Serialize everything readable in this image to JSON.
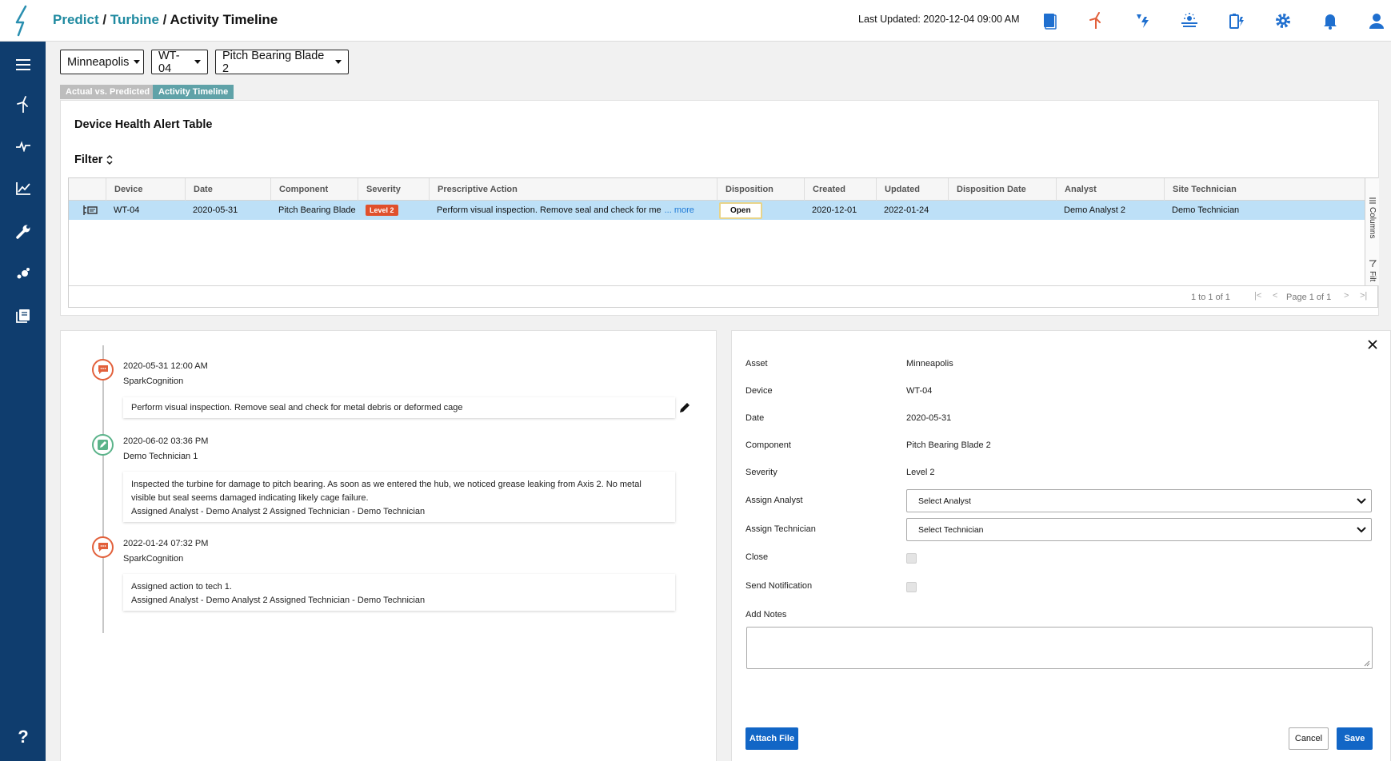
{
  "header": {
    "breadcrumb": [
      {
        "label": "Predict",
        "link": true
      },
      {
        "label": "Turbine",
        "link": true
      },
      {
        "label": "Activity Timeline",
        "link": false
      }
    ],
    "last_updated": "Last Updated: 2020-12-04 09:00 AM",
    "icons": [
      "book-icon",
      "turbine-icon",
      "power-icon",
      "solar-icon",
      "battery-icon",
      "gear-icon",
      "bell-icon",
      "user-icon"
    ]
  },
  "sidebar": {
    "icons": [
      "menu-icon",
      "turbine-icon",
      "pulse-icon",
      "chart-icon",
      "wrench-icon",
      "nodes-icon",
      "library-icon",
      "help-icon"
    ],
    "help_label": "?"
  },
  "selectors": {
    "site": "Minneapolis",
    "device": "WT-04",
    "component": "Pitch Bearing Blade 2"
  },
  "tabs": [
    {
      "label": "Actual vs. Predicted",
      "active": false
    },
    {
      "label": "Activity Timeline",
      "active": true
    }
  ],
  "table": {
    "title": "Device Health Alert Table",
    "filter_label": "Filter",
    "columns": [
      "Device",
      "Date",
      "Component",
      "Severity",
      "Prescriptive Action",
      "Disposition",
      "Created",
      "Updated",
      "Disposition Date",
      "Analyst",
      "Site Technician"
    ],
    "rows": [
      {
        "device": "WT-04",
        "date": "2020-05-31",
        "component": "Pitch Bearing Blade",
        "severity": "Level 2",
        "action": "Perform visual inspection. Remove seal and check for me",
        "more": "... more",
        "disposition": "Open",
        "created": "2020-12-01",
        "updated": "2022-01-24",
        "disposition_date": "",
        "analyst": "Demo Analyst 2",
        "technician": "Demo Technician"
      }
    ],
    "side_tools": {
      "columns": "Columns",
      "filters": "Filt"
    },
    "pagination": {
      "range": "1 to 1 of 1",
      "page": "Page 1 of 1"
    }
  },
  "timeline": [
    {
      "time": "2020-05-31 12:00 AM",
      "author": "SparkCognition",
      "type": "spark",
      "lines": [
        "Perform visual inspection. Remove seal and check for metal debris or deformed cage"
      ]
    },
    {
      "time": "2020-06-02 03:36 PM",
      "author": "Demo Technician 1",
      "type": "tech",
      "lines": [
        "Inspected the turbine for damage to pitch bearing. As soon as we entered the hub, we noticed grease leaking from Axis 2. No metal visible but seal seems damaged indicating likely cage failure.",
        "Assigned Analyst - Demo Analyst 2  Assigned Technician - Demo Technician"
      ]
    },
    {
      "time": "2022-01-24 07:32 PM",
      "author": "SparkCognition",
      "type": "spark",
      "lines": [
        "Assigned action to tech 1.",
        "Assigned Analyst - Demo Analyst 2  Assigned Technician - Demo Technician"
      ]
    }
  ],
  "detail": {
    "fields": [
      {
        "label": "Asset",
        "value": "Minneapolis"
      },
      {
        "label": "Device",
        "value": "WT-04"
      },
      {
        "label": "Date",
        "value": "2020-05-31"
      },
      {
        "label": "Component",
        "value": "Pitch Bearing Blade 2"
      },
      {
        "label": "Severity",
        "value": "Level 2"
      }
    ],
    "assign_analyst_label": "Assign Analyst",
    "assign_analyst_value": "Select Analyst",
    "assign_technician_label": "Assign Technician",
    "assign_technician_value": "Select Technician",
    "close_label": "Close",
    "send_notification_label": "Send Notification",
    "add_notes_label": "Add Notes",
    "attach_label": "Attach File",
    "cancel_label": "Cancel",
    "save_label": "Save"
  },
  "colors": {
    "sidebar": "#0f3d6e",
    "accent": "#1f8aa0",
    "primary_button": "#1266c6",
    "severity_badge": "#e0502c",
    "row_selected": "#bde0f7"
  }
}
